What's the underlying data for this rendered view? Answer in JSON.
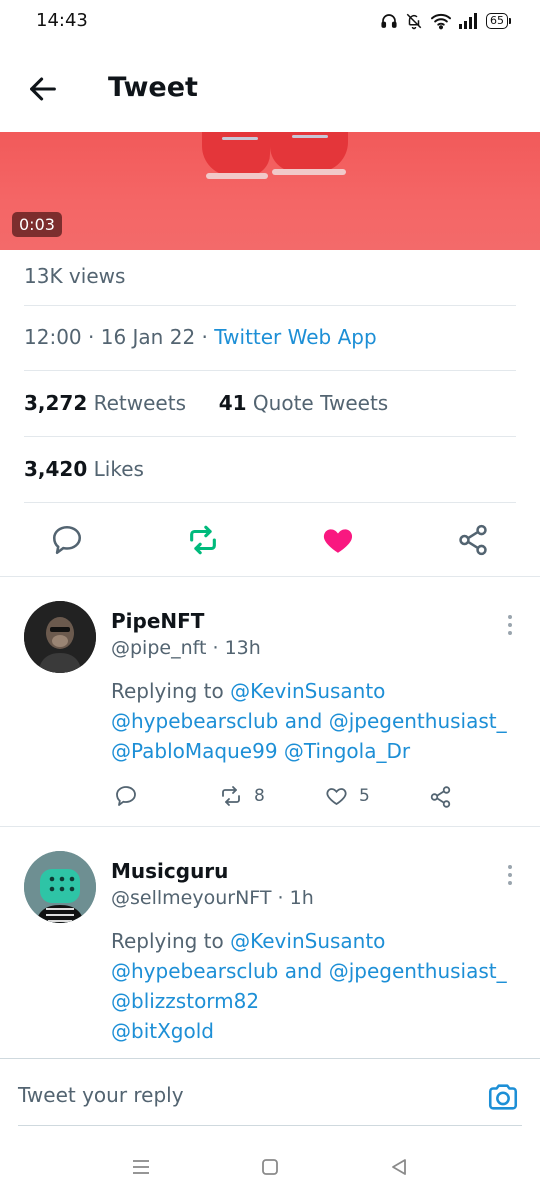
{
  "status_bar": {
    "time": "14:43",
    "battery": "65"
  },
  "header": {
    "title": "Tweet"
  },
  "video": {
    "duration": "0:03"
  },
  "stats": {
    "views": "13K views",
    "time": "12:00",
    "date": "16 Jan 22",
    "source": "Twitter Web App",
    "retweets_count": "3,272",
    "retweets_label": "Retweets",
    "quotes_count": "41",
    "quotes_label": "Quote Tweets",
    "likes_count": "3,420",
    "likes_label": "Likes"
  },
  "colors": {
    "link": "#1d8fd6",
    "retweet_active": "#00ba7c",
    "like_active": "#f91880"
  },
  "replies": [
    {
      "name": "PipeNFT",
      "handle": "@pipe_nft",
      "time": "13h",
      "replying_to_label": "Replying to",
      "mention1": "@KevinSusanto",
      "line2_a": "@hypebearsclub",
      "line2_and": "and",
      "line2_b": "@jpegenthusiast_",
      "line3_a": "@PabloMaque99",
      "line3_b": "@Tingola_Dr",
      "retweets": "8",
      "likes": "5"
    },
    {
      "name": "Musicguru",
      "handle": "@sellmeyourNFT",
      "time": "1h",
      "replying_to_label": "Replying to",
      "mention1": "@KevinSusanto",
      "line2_a": "@hypebearsclub",
      "line2_and": "and",
      "line2_b": "@jpegenthusiast_",
      "line3_a": "@blizzstorm82",
      "line4_a": "@bitXgold"
    }
  ],
  "composer": {
    "placeholder": "Tweet your reply"
  }
}
